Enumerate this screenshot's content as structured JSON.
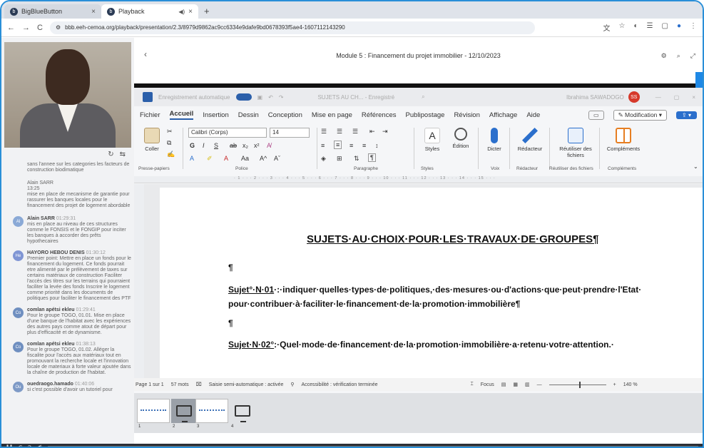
{
  "browser": {
    "tabs": [
      {
        "label": "BigBlueButton"
      },
      {
        "label": "Playback"
      }
    ],
    "address": "bbb.eeh-cemoa.org/playback/presentation/2.3/8979d9862ac9cc6334e9dafe9bd0678393f5ae4-1607112143290",
    "address_prefix": "bbb.eeh-cemoa.org/pl"
  },
  "chat": {
    "messages": [
      {
        "author": "",
        "time": "",
        "text": "sans l'annee sur les categories les facteurs de construction biodimatique",
        "avatar": ""
      },
      {
        "author": "Alain SARR",
        "time": "13:25",
        "text": "mise en place de mecanisme de garantie pour rassurer les banques locales pour le financement des projet de logement abordable",
        "avatar": "",
        "plain": true
      },
      {
        "author": "Alain SARR",
        "time": "01:29:31",
        "text": "mis en place au niveau de ces structures comme le FONSIS et le FONGIP pour inciter les banques à accorder des prêts hypothecaires",
        "avatar": "Al"
      },
      {
        "author": "HAYORO HEBOU DENIS",
        "time": "01:30:12",
        "text": "Premier point: Mettre en place un fonds pour le financement du logement. Ce fonds pourrait etre alimenté par le prélèvement de taxes sur certains matériaux de construction Faciliter l'accès des titres sur les terrains qui pourraient faciliter la levée des fonds Inscrire le logement comme priorité dans les documents de politiques pour faciliter le financement des PTF",
        "avatar": "He"
      },
      {
        "author": "comlan apétsi ekleu",
        "time": "01:29:41",
        "text": "Pour le groupe TOGO, 01.01. Mise en place d'une banque de l'habitat avec les expériences des autres pays comme atout de départ pour plus d'efficacité et de dynamisme.",
        "avatar": "Co"
      },
      {
        "author": "comlan apétsi ekleu",
        "time": "01:38:13",
        "text": "Pour le groupe TOGO, 01.02. Alléger la fiscalite pour l'accès aux matériaux tout en promouvant la recherche locale et l'innovation locale de materiaux à forte valeur ajoutée dans la chaîne de production de l'habitat.",
        "avatar": "Co"
      },
      {
        "author": "ouedraogo.hamado",
        "time": "01:40:06",
        "text": "si c'est possible d'avoir un tutoriel pour",
        "avatar": "Ou"
      }
    ]
  },
  "presentation": {
    "title": "Module 5 : Financement du projet immobilier - 12/10/2023",
    "back_icon": "chevron-left-icon"
  },
  "word": {
    "autosave_label": "Enregistrement automatique",
    "doc_name": "SUJETS AU CH... - Enregistré",
    "search_placeholder": "",
    "user_name": "Ibrahima SAWADOGO",
    "user_initials": "SS",
    "menu": [
      "Fichier",
      "Accueil",
      "Insertion",
      "Dessin",
      "Conception",
      "Mise en page",
      "Références",
      "Publipostage",
      "Révision",
      "Affichage",
      "Aide"
    ],
    "mode_label": "Modification",
    "ribbon": {
      "coller": "Coller",
      "presse_papiers": "Presse-papiers",
      "font_name": "Calibri (Corps)",
      "font_size": "14",
      "police": "Police",
      "paragraphe": "Paragraphe",
      "styles": "Styles",
      "styles_group": "Styles",
      "edition": "Édition",
      "dicter": "Dicter",
      "voix": "Voix",
      "redacteur": "Rédacteur",
      "redacteur_group": "Rédacteur",
      "reutiliser": "Réutiliser des fichiers",
      "reutiliser_group": "Réutiliser des fichiers",
      "complements": "Compléments",
      "complements_group": "Compléments"
    },
    "document": {
      "title": "SUJETS·AU·CHOIX·POUR·LES·TRAVAUX·DE·GROUPES¶",
      "pilcrow": "¶",
      "subject1_label": "Sujet°·N·01",
      "subject1_text": "·:·indiquer·quelles·types·de·politiques,·des·mesures·ou·d'actions·que·peut·prendre·l'Etat· pour·contribuer·à·faciliter·le·financement·de·la·promotion·immobilière¶",
      "subject2_label": "Sujet·N·02°",
      "subject2_text": ":·Quel·mode·de·financement·de·la·promotion·immobilière·a·retenu·votre·attention.·"
    },
    "status": {
      "page": "Page 1 sur 1",
      "words": "57 mots",
      "autosave": "Saisie semi-automatique : activée",
      "accessibility": "Accessibilité : vérification terminée",
      "focus": "Focus",
      "zoom": "140 %"
    }
  },
  "strip": {
    "numbers": [
      "1",
      "2",
      "3",
      "4"
    ]
  },
  "colors": {
    "accent": "#2b5faa",
    "frame": "#2a8fd8",
    "user_badge": "#d6392b"
  }
}
